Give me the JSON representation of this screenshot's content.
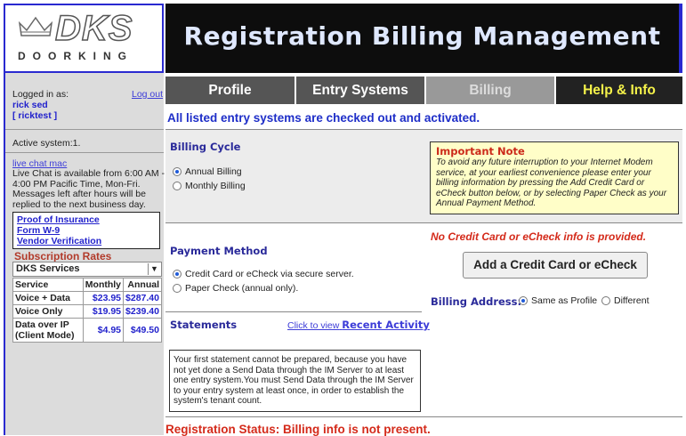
{
  "header": {
    "logo_brand": "DKS",
    "logo_sub": "DOORKING",
    "title": "Registration Billing Management"
  },
  "sidebar": {
    "logged_in_label": "Logged in as:",
    "logout_label": "Log out",
    "user_name": "rick sed",
    "user_id": "[ ricktest ]",
    "active_system": "Active system:1.",
    "chat_link": "live chat mac",
    "chat_text": "Live Chat is available from 6:00 AM - 4:00 PM Pacific Time, Mon-Fri. Messages left after hours will be replied to the next business day.",
    "docs": [
      "Proof of Insurance",
      "Form W-9",
      "Vendor Verification"
    ],
    "rates_title": "Subscription Rates",
    "rates_select": "DKS Services",
    "rates_headers": [
      "Service",
      "Monthly",
      "Annual"
    ],
    "rates_rows": [
      {
        "service": "Voice + Data",
        "monthly": "$23.95",
        "annual": "$287.40"
      },
      {
        "service": "Voice Only",
        "monthly": "$19.95",
        "annual": "$239.40"
      },
      {
        "service": "Data over IP (Client Mode)",
        "monthly": "$4.95",
        "annual": "$49.50"
      }
    ]
  },
  "tabs": [
    "Profile",
    "Entry Systems",
    "Billing",
    "Help & Info"
  ],
  "main": {
    "status_line": "All listed entry systems are checked out and activated.",
    "billing_cycle_title": "Billing Cycle",
    "annual_billing": "Annual Billing",
    "monthly_billing": "Monthly Billing",
    "note_title": "Important Note",
    "note_text": "To avoid any future interruption to your Internet Modem service, at your earliest convenience please enter your billing information by pressing the Add Credit Card or eCheck button below, or by selecting Paper Check as your Annual Payment Method.",
    "no_card_msg": "No Credit Card or eCheck info is provided.",
    "payment_title": "Payment Method",
    "pay_card": "Credit Card or eCheck via secure server.",
    "pay_paper": "Paper Check (annual only).",
    "add_card_button": "Add a Credit Card or eCheck",
    "billing_address_label": "Billing Address:",
    "addr_same": "Same as Profile",
    "addr_diff": "Different",
    "statements_title": "Statements",
    "activity_prefix": "Click to view",
    "activity_link": "Recent Activity",
    "statement_text": "Your first statement cannot be prepared, because you have not yet done a Send Data through the IM Server to at least one entry system.You must Send Data through the IM Server to your entry system at least once, in order to establish the system's tenant count.",
    "bottom_status": "Registration Status: Billing info is not present."
  },
  "selected": {
    "billing_cycle": "Annual Billing",
    "payment_method": "Credit Card or eCheck via secure server.",
    "billing_address": "Same as Profile"
  },
  "colors": {
    "title_bar": "#0d0d0d",
    "title_text": "#dfe8ff",
    "tab_default": "#555555",
    "tab_active": "#999999",
    "tab_help_text": "#f5f24a",
    "heading_blue": "#1e2ec8",
    "alert_red": "#d42a1a",
    "note_bg": "#fffec8"
  }
}
